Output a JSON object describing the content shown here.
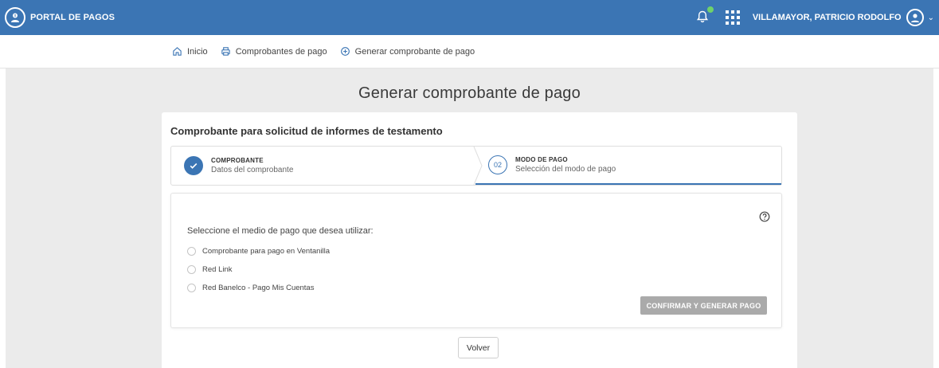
{
  "app": {
    "brand": "PORTAL DE PAGOS"
  },
  "header": {
    "user_name": "VILLAMAYOR, PATRICIO RODOLFO",
    "notification_dot_color": "#6fd26a",
    "accent_color": "#3b75b4"
  },
  "breadcrumb": [
    {
      "label": "Inicio",
      "icon": "home-icon"
    },
    {
      "label": "Comprobantes de pago",
      "icon": "print-icon"
    },
    {
      "label": "Generar comprobante de pago",
      "icon": "plus-circle-icon"
    }
  ],
  "page": {
    "title": "Generar comprobante de pago",
    "card_title": "Comprobante para solicitud de informes de testamento"
  },
  "stepper": {
    "steps": [
      {
        "title": "COMPROBANTE",
        "subtitle": "Datos del comprobante",
        "status": "completed",
        "icon": "check-icon"
      },
      {
        "number": "02",
        "title": "MODO DE PAGO",
        "subtitle": "Selección del modo de pago",
        "status": "active"
      }
    ]
  },
  "payment": {
    "question": "Seleccione el medio de pago que desea utilizar:",
    "options": [
      {
        "label": "Comprobante para pago en Ventanilla",
        "selected": false
      },
      {
        "label": "Red Link",
        "selected": false
      },
      {
        "label": "Red Banelco - Pago Mis Cuentas",
        "selected": false
      }
    ],
    "confirm_label": "CONFIRMAR Y GENERAR PAGO",
    "confirm_disabled": true
  },
  "actions": {
    "back_label": "Volver"
  }
}
